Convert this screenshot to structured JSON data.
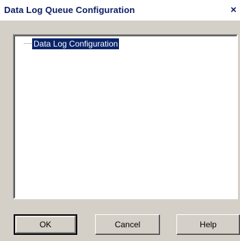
{
  "window": {
    "title": "Data Log Queue Configuration",
    "close_glyph": "×"
  },
  "tree": {
    "nodes": [
      {
        "label": "Data Log Configuration",
        "selected": true
      }
    ]
  },
  "buttons": {
    "ok_label": "OK",
    "cancel_label": "Cancel",
    "help_label": "Help"
  },
  "colors": {
    "selection": "#0a246a",
    "title_text": "#0b1c63",
    "face": "#d4d0c8"
  }
}
